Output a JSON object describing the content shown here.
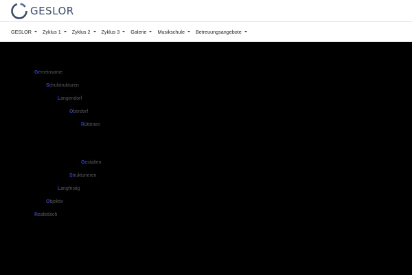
{
  "brand": {
    "name": "GESLOR",
    "logo_icon": "ring-logo-icon",
    "color": "#3b4a6b"
  },
  "nav": {
    "items": [
      {
        "label": "GESLOR",
        "icon": "caret-down-icon"
      },
      {
        "label": "Zyklus 1",
        "icon": "caret-down-icon"
      },
      {
        "label": "Zyklus 2",
        "icon": "caret-down-icon"
      },
      {
        "label": "Zyklus 3",
        "icon": "caret-down-icon"
      },
      {
        "label": "Galerie",
        "icon": "caret-down-icon"
      },
      {
        "label": "Musikschule",
        "icon": "caret-down-icon"
      },
      {
        "label": "Betreuungsangebote",
        "icon": "caret-down-icon"
      }
    ]
  },
  "acronym": {
    "accent_color": "#3240c6",
    "text_color": "#5a5a5a",
    "lines": [
      {
        "first": "G",
        "rest": "emeinsame"
      },
      {
        "first": "S",
        "rest": "chulstrukturen"
      },
      {
        "first": "L",
        "rest": "angendorf"
      },
      {
        "first": "O",
        "rest": "berdorf"
      },
      {
        "first": "R",
        "rest": "üttenen"
      },
      {
        "first": "G",
        "rest": "estalten"
      },
      {
        "first": "S",
        "rest": "trukturieren"
      },
      {
        "first": "L",
        "rest": "angfristig"
      },
      {
        "first": "O",
        "rest": "bjektiv"
      },
      {
        "first": "R",
        "rest": "ealistisch"
      }
    ]
  }
}
